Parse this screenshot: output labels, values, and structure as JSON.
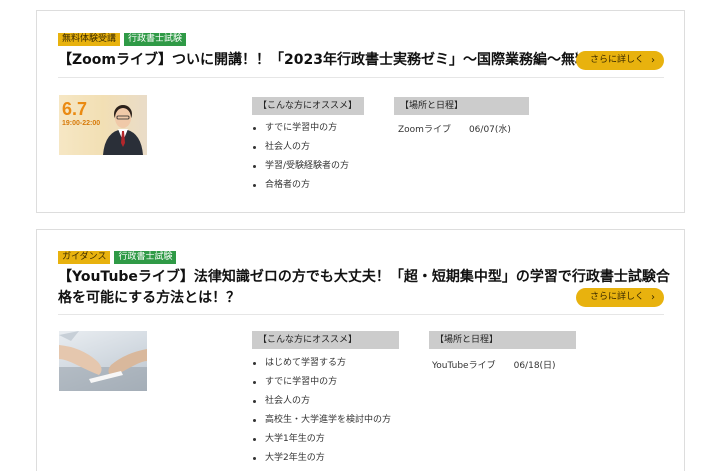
{
  "events": [
    {
      "tags": [
        {
          "label": "無料体験受講",
          "color": "#e8b20e"
        },
        {
          "label": "行政書士試験",
          "color": "#2f9a46"
        }
      ],
      "title": "【Zoomライブ】ついに開講！！「2023年行政書士実務ゼミ」～国際業務編～無料体",
      "more_label": "さらに詳しく",
      "thumbnail": {
        "date": "6.7",
        "time": "19:00-22:00"
      },
      "recommend_heading": "【こんな方にオススメ】",
      "recommend": [
        "すでに学習中の方",
        "社会人の方",
        "学習/受験経験者の方",
        "合格者の方"
      ],
      "schedule_heading": "【場所と日程】",
      "schedule": {
        "place": "Zoomライブ",
        "date": "06/07(水)"
      }
    },
    {
      "tags": [
        {
          "label": "ガイダンス",
          "color": "#e8b20e"
        },
        {
          "label": "行政書士試験",
          "color": "#2f9a46"
        }
      ],
      "title": "【YouTubeライブ】法律知識ゼロの方でも大丈夫！「超・短期集中型」の学習で行政書士試験合格を可能にする方法とは！？",
      "more_label": "さらに詳しく",
      "recommend_heading": "【こんな方にオススメ】",
      "recommend": [
        "はじめて学習する方",
        "すでに学習中の方",
        "社会人の方",
        "高校生・大学進学を検討中の方",
        "大学1年生の方",
        "大学2年生の方"
      ],
      "schedule_heading": "【場所と日程】",
      "schedule": {
        "place": "YouTubeライブ",
        "date": "06/18(日)"
      }
    }
  ]
}
